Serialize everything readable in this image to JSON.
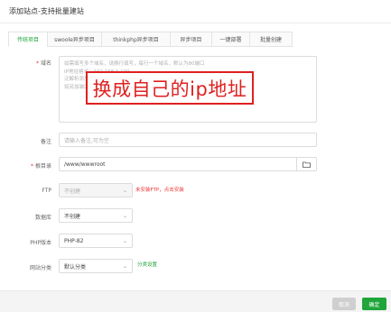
{
  "dialog": {
    "title": "添加站点-支持批量建站"
  },
  "tabs": [
    {
      "label": "传统项目",
      "active": true
    },
    {
      "label": "swoole异步项目",
      "active": false
    },
    {
      "label": "thinkphp异步项目",
      "active": false
    },
    {
      "label": "异步项目",
      "active": false
    },
    {
      "label": "一键部署",
      "active": false
    },
    {
      "label": "批量创建",
      "active": false
    }
  ],
  "form": {
    "domain": {
      "label": "域名",
      "placeholder_lines": [
        "如需填写多个域名，请换行填写，每行一个域名，默认为80端口",
        "IP地址格式：192.168.1.199",
        "泛解析添加方法 *.domain.com",
        "如另加端口格式为 www.domain.com:88"
      ]
    },
    "note": {
      "label": "备注",
      "placeholder": "请输入备注,可为空"
    },
    "root": {
      "label": "根目录",
      "value": "/www/wwwroot"
    },
    "ftp": {
      "label": "FTP",
      "value": "不创建",
      "hint": "未安装FTP，点击安装"
    },
    "database": {
      "label": "数据库",
      "value": "不创建"
    },
    "php": {
      "label": "PHP版本",
      "value": "PHP-82"
    },
    "category": {
      "label": "网站分类",
      "value": "默认分类",
      "link": "分类设置"
    }
  },
  "annotation": {
    "text": "换成自己的ip地址",
    "color": "#e02020"
  },
  "buttons": {
    "cancel": "取消",
    "confirm": "确定"
  },
  "colors": {
    "accent": "#20a53a",
    "required": "#e33333"
  }
}
